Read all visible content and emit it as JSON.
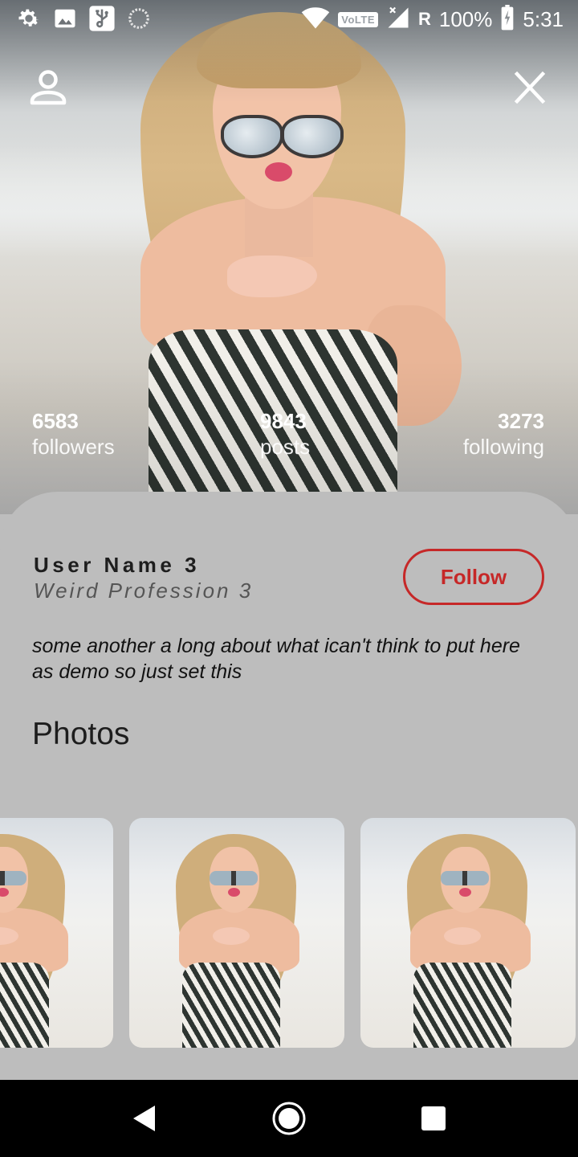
{
  "status_bar": {
    "left_icons": [
      "settings-icon",
      "image-icon",
      "usb-icon",
      "sync-icon"
    ],
    "right_icons": [
      "wifi-icon",
      "volte-badge",
      "signal-icon",
      "roaming-indicator",
      "battery-icon"
    ],
    "volte_label": "VoLTE",
    "roaming_label": "R",
    "battery": "100%",
    "time": "5:31"
  },
  "header": {
    "profile_icon": "person-icon",
    "close_icon": "close-icon"
  },
  "stats": {
    "followers": {
      "count": "6583",
      "label": "followers"
    },
    "posts": {
      "count": "9843",
      "label": "posts"
    },
    "following": {
      "count": "3273",
      "label": "following"
    }
  },
  "profile": {
    "user_name": "User Name 3",
    "profession": "Weird Profession 3",
    "follow_label": "Follow",
    "bio": "some another a long about what ican't think to put here as demo so just set this"
  },
  "photos": {
    "title": "Photos",
    "items": [
      "photo-thumbnail",
      "photo-thumbnail",
      "photo-thumbnail"
    ]
  },
  "nav_bar": {
    "icons": [
      "back-icon",
      "home-icon",
      "recent-apps-icon"
    ]
  },
  "colors": {
    "accent": "#c62828",
    "sheet_background": "#bdbdbd",
    "nav_background": "#000000"
  }
}
